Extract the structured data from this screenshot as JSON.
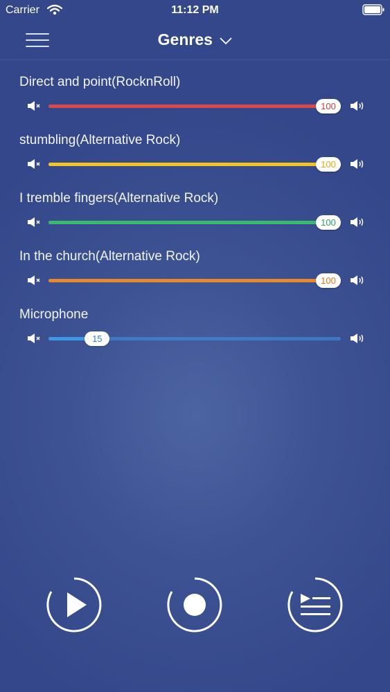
{
  "status_bar": {
    "carrier": "Carrier",
    "time": "11:12 PM"
  },
  "nav": {
    "title": "Genres"
  },
  "tracks": [
    {
      "name": "Direct and point(RocknRoll)",
      "volume": 100,
      "volume_label": "100",
      "color": "#d84a4a",
      "text_color": "#c24141"
    },
    {
      "name": "stumbling(Alternative Rock)",
      "volume": 100,
      "volume_label": "100",
      "color": "#f4c51f",
      "text_color": "#e0ad12"
    },
    {
      "name": "I tremble fingers(Alternative Rock)",
      "volume": 100,
      "volume_label": "100",
      "color": "#38bb6a",
      "text_color": "#2aa05a"
    },
    {
      "name": "In the church(Alternative Rock)",
      "volume": 100,
      "volume_label": "100",
      "color": "#e8892c",
      "text_color": "#d7781b"
    },
    {
      "name": "Microphone",
      "volume": 15,
      "volume_label": "15",
      "color": "#3f98e6",
      "text_color": "#2e7fc8"
    }
  ],
  "controls": [
    "play-icon",
    "record-icon",
    "playlist-icon"
  ]
}
